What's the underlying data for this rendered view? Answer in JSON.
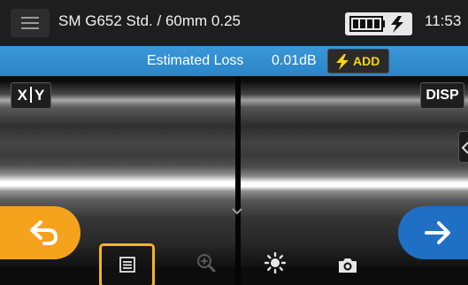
{
  "status_bar": {
    "menu_icon": "hamburger-icon",
    "title": "SM G652 Std. / 60mm 0.25",
    "battery_icon": "battery-charging-icon",
    "time": "11:53"
  },
  "loss_bar": {
    "label": "Estimated Loss",
    "value": "0.01dB",
    "add_button": {
      "icon": "lightning-icon",
      "label": "ADD"
    }
  },
  "fiber_view": {
    "xy_button": {
      "x": "X",
      "y": "Y"
    },
    "disp_button": "DISP"
  },
  "toolbar": {
    "back_icon": "back-arrow-icon",
    "report_icon": "report-icon",
    "zoom_icon": "zoom-in-icon",
    "brightness_icon": "brightness-icon",
    "camera_icon": "camera-icon",
    "next_icon": "next-arrow-icon"
  },
  "colors": {
    "accent_orange": "#f5a21c",
    "accent_blue": "#1f6fc4",
    "loss_banner": "#2f8bcc",
    "add_yellow": "#f7d61c"
  }
}
